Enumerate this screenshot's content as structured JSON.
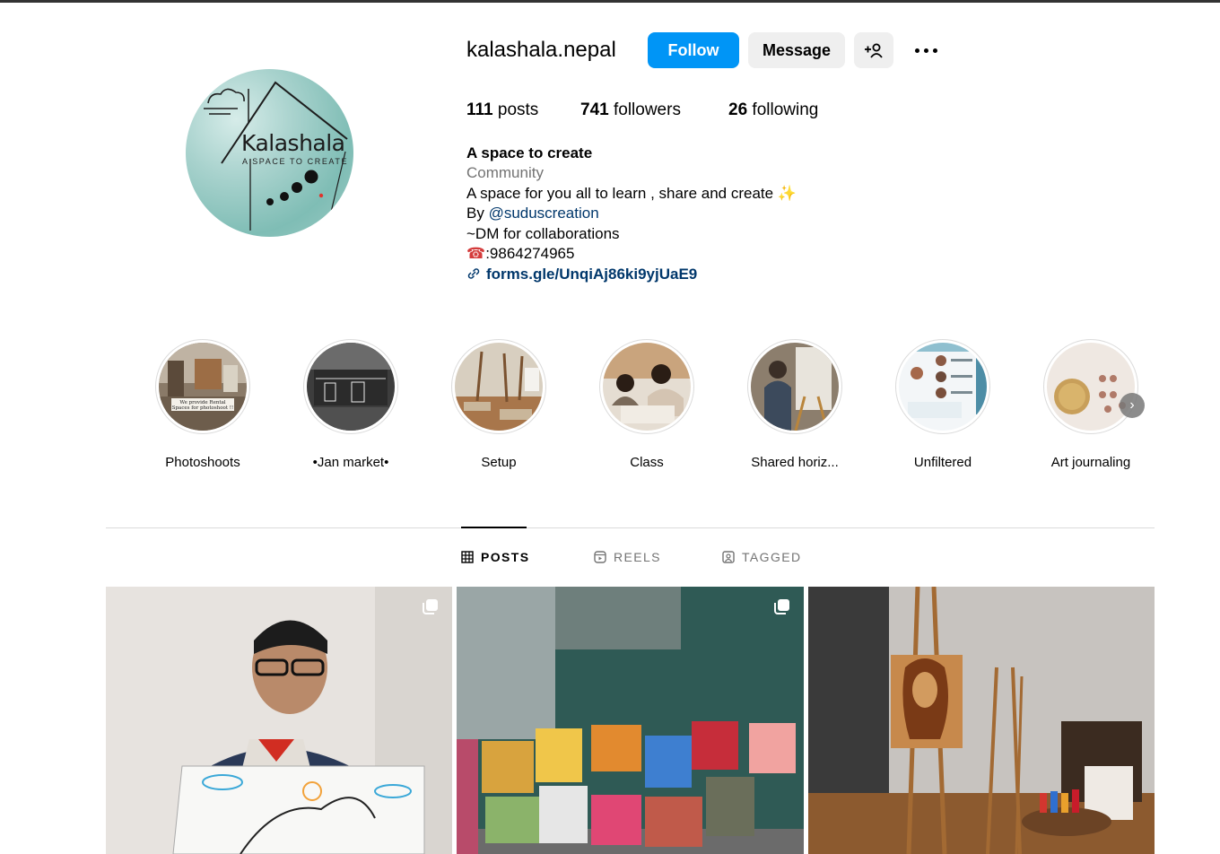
{
  "profile": {
    "username": "kalashala.nepal",
    "follow_label": "Follow",
    "message_label": "Message",
    "add_user_icon": "add-user-icon",
    "more_icon": "more-icon",
    "avatar": {
      "logo_text": "Kalashala",
      "logo_tagline": "A SPACE TO CREATE"
    },
    "stats": {
      "posts_count": "111",
      "posts_label": "posts",
      "followers_count": "741",
      "followers_label": "followers",
      "following_count": "26",
      "following_label": "following"
    },
    "bio": {
      "name": "A space to create",
      "category": "Community",
      "line1": "A space for you all to learn , share and create ✨",
      "by_label": "By ",
      "mention": "@suduscreation",
      "line3": "~DM for collaborations",
      "phone_icon": "☎",
      "phone": ":9864274965",
      "link_icon": "link-icon",
      "link": "forms.gle/UnqiAj86ki9yjUaE9"
    }
  },
  "highlights": [
    {
      "label": "Photoshoots",
      "overlay_text": "We provide Rental Spaces for photoshoot !!"
    },
    {
      "label": "•Jan market•"
    },
    {
      "label": "Setup"
    },
    {
      "label": "Class"
    },
    {
      "label": "Shared horiz..."
    },
    {
      "label": "Unfiltered"
    },
    {
      "label": "Art journaling"
    }
  ],
  "tabs": [
    {
      "label": "POSTS",
      "icon": "grid-icon",
      "active": true
    },
    {
      "label": "REELS",
      "icon": "reels-icon",
      "active": false
    },
    {
      "label": "TAGGED",
      "icon": "tagged-icon",
      "active": false
    }
  ],
  "colors": {
    "follow_bg": "#0095f6",
    "secondary_bg": "#efefef",
    "mention": "#00376b",
    "muted": "#737373"
  }
}
